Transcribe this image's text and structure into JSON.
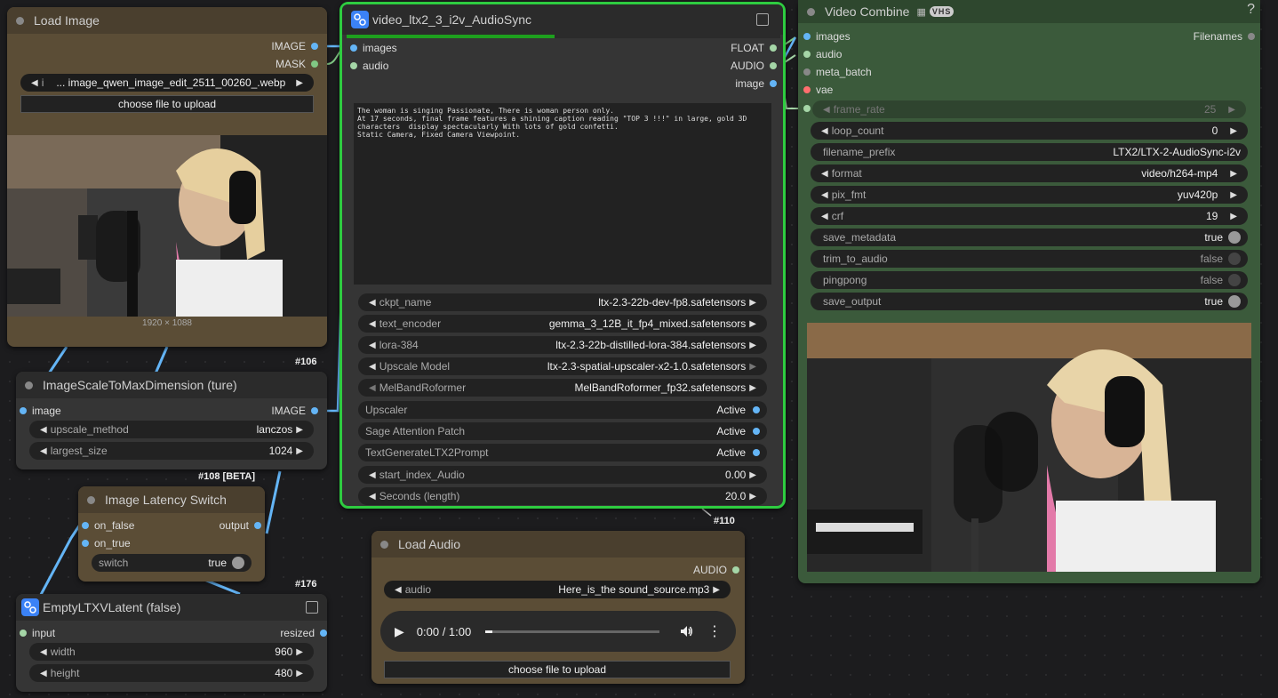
{
  "load_image": {
    "title": "Load Image",
    "outputs": [
      "IMAGE",
      "MASK"
    ],
    "image_field_arrow": "i",
    "image_field_value": "... image_qwen_image_edit_2511_00260_.webp",
    "upload_label": "choose file to upload",
    "dimensions": "1920 × 1088"
  },
  "scale_node": {
    "id": "#106",
    "title": "ImageScaleToMaxDimension (ture)",
    "input": "image",
    "output": "IMAGE",
    "widgets": [
      {
        "label": "upscale_method",
        "value": "lanczos"
      },
      {
        "label": "largest_size",
        "value": "1024"
      }
    ]
  },
  "latency_switch": {
    "id": "#108 [BETA]",
    "title": "Image Latency Switch",
    "inputs": [
      "on_false",
      "on_true"
    ],
    "output": "output",
    "switch_label": "switch",
    "switch_value": "true"
  },
  "empty_latent": {
    "id": "#176",
    "title": "EmptyLTXVLatent (false)",
    "input": "input",
    "output": "resized",
    "widgets": [
      {
        "label": "width",
        "value": "960"
      },
      {
        "label": "height",
        "value": "480"
      }
    ]
  },
  "main_node": {
    "title": "video_ltx2_3_i2v_AudioSync",
    "inputs": [
      "images",
      "audio"
    ],
    "outputs": [
      "FLOAT",
      "AUDIO",
      "image"
    ],
    "prompt": "The woman is singing Passionate, There is woman person only.\nAt 17 seconds, final frame features a shining caption reading \"TOP 3 !!!\" in large, gold 3D\ncharacters  display spectacularly With lots of gold confetti.\nStatic Camera, Fixed Camera Viewpoint.",
    "widgets": [
      {
        "label": "ckpt_name",
        "value": "ltx-2.3-22b-dev-fp8.safetensors"
      },
      {
        "label": "text_encoder",
        "value": "gemma_3_12B_it_fp4_mixed.safetensors"
      },
      {
        "label": "lora-384",
        "value": "ltx-2.3-22b-distilled-lora-384.safetensors"
      },
      {
        "label": "Upscale Model",
        "value": "ltx-2.3-spatial-upscaler-x2-1.0.safetensors"
      },
      {
        "label": "MelBandRoformer",
        "value": "MelBandRoformer_fp32.safetensors"
      }
    ],
    "toggles": [
      {
        "label": "Upscaler",
        "value": "Active"
      },
      {
        "label": "Sage Attention Patch",
        "value": "Active"
      },
      {
        "label": "TextGenerateLTX2Prompt",
        "value": "Active"
      }
    ],
    "numbers": [
      {
        "label": "start_index_Audio",
        "value": "0.00"
      },
      {
        "label": "Seconds (length)",
        "value": "20.0"
      }
    ],
    "progress": 0.48
  },
  "load_audio": {
    "id": "#110",
    "title": "Load Audio",
    "output": "AUDIO",
    "widget_label": "audio",
    "widget_value": "Here_is_the sound_source.mp3",
    "time": "0:00 / 1:00",
    "upload_label": "choose file to upload"
  },
  "video_combine": {
    "title": "Video Combine",
    "badge": "VHS",
    "help": "?",
    "inputs": [
      "images",
      "audio",
      "meta_batch",
      "vae"
    ],
    "output": "Filenames",
    "frame_rate_label": "frame_rate",
    "frame_rate_value": "25",
    "widgets": [
      {
        "label": "loop_count",
        "value": "0"
      },
      {
        "label": "filename_prefix",
        "value": "LTX2/LTX-2-AudioSync-i2v"
      },
      {
        "label": "format",
        "value": "video/h264-mp4"
      },
      {
        "label": "pix_fmt",
        "value": "yuv420p"
      },
      {
        "label": "crf",
        "value": "19"
      }
    ],
    "toggles": [
      {
        "label": "save_metadata",
        "value": "true"
      },
      {
        "label": "trim_to_audio",
        "value": "false"
      },
      {
        "label": "pingpong",
        "value": "false"
      },
      {
        "label": "save_output",
        "value": "true"
      }
    ]
  },
  "colors": {
    "image_socket": "#64b5f6",
    "audio_socket": "#a5d6a7",
    "mask_socket": "#81c784",
    "vae_socket": "#ff6e6e",
    "selected_outline": "#2ecc40",
    "load_node_body": "#5b4d36",
    "combine_body": "#3b5a3b"
  }
}
